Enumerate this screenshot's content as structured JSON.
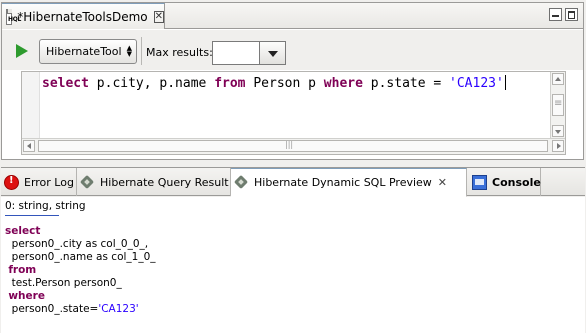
{
  "editor": {
    "tab_title": "*HibernateToolsDemo",
    "icon_text": "HQL",
    "config_value": "HibernateTool",
    "max_results_label": "Max results:",
    "max_results_value": "",
    "query": {
      "kw_select": "select",
      "part1": " p.city, p.name ",
      "kw_from": "from",
      "part2": " Person p ",
      "kw_where": "where",
      "part3": " p.state = ",
      "string": "'CA123'"
    }
  },
  "panel": {
    "tabs": [
      {
        "label": "Error Log",
        "icon": "error-log-icon"
      },
      {
        "label": "Hibernate Query Result",
        "icon": "hibernate-icon"
      },
      {
        "label": "Hibernate Dynamic SQL Preview",
        "icon": "hibernate-icon",
        "active": true
      },
      {
        "label": "Console",
        "icon": "console-icon"
      }
    ],
    "columns_info": "0: string, string",
    "sql": {
      "kw_select": "select",
      "line1": "  person0_.city as col_0_0_,",
      "line2": "  person0_.name as col_1_0_",
      "kw_from": "from",
      "line3": "  test.Person person0_",
      "kw_where": "where",
      "line4_prefix": "  person0_.state=",
      "line4_string": "'CA123'"
    }
  },
  "colors": {
    "keyword": "#7f0055",
    "string": "#2a00ff",
    "run_green": "#2e9b2e"
  }
}
